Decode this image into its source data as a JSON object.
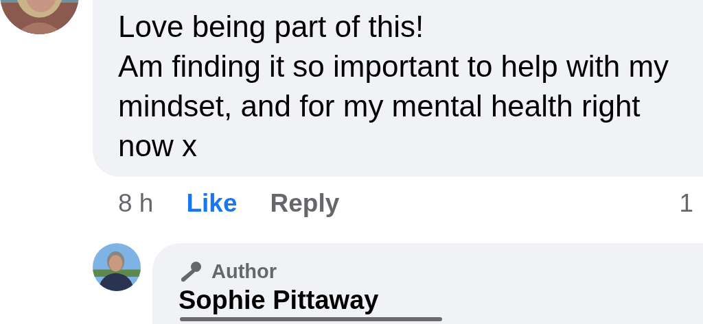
{
  "comments": [
    {
      "paragraphs": [
        "Love being part of this!",
        "Am finding it so important to help with my mindset, and for my mental health right now x"
      ],
      "time": "8 h",
      "like": {
        "label": "Like",
        "selected": true
      },
      "reply": "Reply",
      "reaction_count": "1"
    },
    {
      "badge": "Author",
      "author": "Sophie Pittaway"
    }
  ]
}
